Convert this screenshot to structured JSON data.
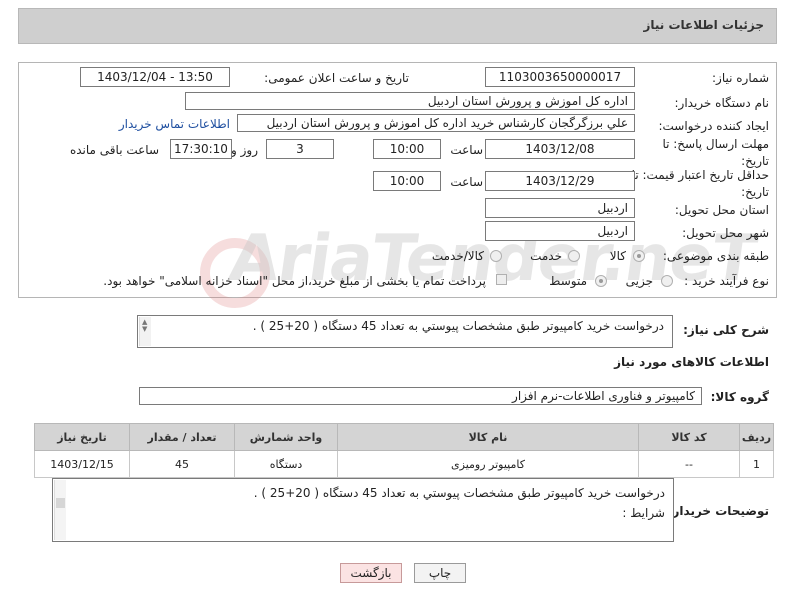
{
  "header": {
    "title": "جزئیات اطلاعات نیاز"
  },
  "fields": {
    "need_number_label": "شماره نیاز:",
    "need_number": "1103003650000017",
    "announce_label": "تاریخ و ساعت اعلان عمومی:",
    "announce_value": "1403/12/04 - 13:50",
    "buyer_org_label": "نام دستگاه خریدار:",
    "buyer_org": "اداره کل اموزش و پرورش استان اردبیل",
    "creator_label": "ایجاد کننده درخواست:",
    "creator": "علي برزگرگجان کارشناس خريد اداره كل اموزش و پرورش استان اردبيل",
    "contact_link": "اطلاعات تماس خریدار",
    "deadline_label": "مهلت ارسال پاسخ: تا تاریخ:",
    "deadline_date": "1403/12/08",
    "time_label": "ساعت",
    "deadline_time": "10:00",
    "days": "3",
    "days_label": "روز و",
    "remain_time": "17:30:10",
    "remain_label": "ساعت باقی مانده",
    "price_label": "حداقل تاریخ اعتبار قیمت: تا تاریخ:",
    "price_date": "1403/12/29",
    "price_time": "10:00",
    "province_label": "استان محل تحویل:",
    "province": "اردبیل",
    "city_label": "شهر محل تحویل:",
    "city": "اردبیل",
    "category_label": "طبقه بندی موضوعی:",
    "cat_goods": "کالا",
    "cat_service": "خدمت",
    "cat_both": "کالا/خدمت",
    "process_label": "نوع فرآیند خرید :",
    "proc_partial": "جزیی",
    "proc_medium": "متوسط",
    "payment_note": "پرداخت تمام یا بخشی از مبلغ خرید،از محل \"اسناد خزانه اسلامی\" خواهد بود."
  },
  "description": {
    "label": "شرح کلی نیاز:",
    "text": "درخواست خريد كامپيوتر طبق مشخصات پيوستي به تعداد 45 دستگاه ( 20+25 ) ."
  },
  "goods_section": {
    "title": "اطلاعات کالاهای مورد نیاز"
  },
  "goods_group": {
    "label": "گروه کالا:",
    "value": "کامپیوتر و فناوری اطلاعات-نرم افزار"
  },
  "table": {
    "headers": [
      "ردیف",
      "کد کالا",
      "نام کالا",
      "واحد شمارش",
      "تعداد / مقدار",
      "تاریخ نیاز"
    ],
    "rows": [
      {
        "row": "1",
        "code": "--",
        "name": "کامپیوتر رومیزی",
        "unit": "دستگاه",
        "qty": "45",
        "date": "1403/12/15"
      }
    ]
  },
  "buyer_notes": {
    "label": "توضیحات خریدار:",
    "line1": "درخواست خريد كامپيوتر طبق مشخصات پيوستي به تعداد 45 دستگاه ( 20+25 ) .",
    "line2": "شرایط :"
  },
  "buttons": {
    "print": "چاپ",
    "back": "بازگشت"
  },
  "watermark": "AriaTender.neT"
}
